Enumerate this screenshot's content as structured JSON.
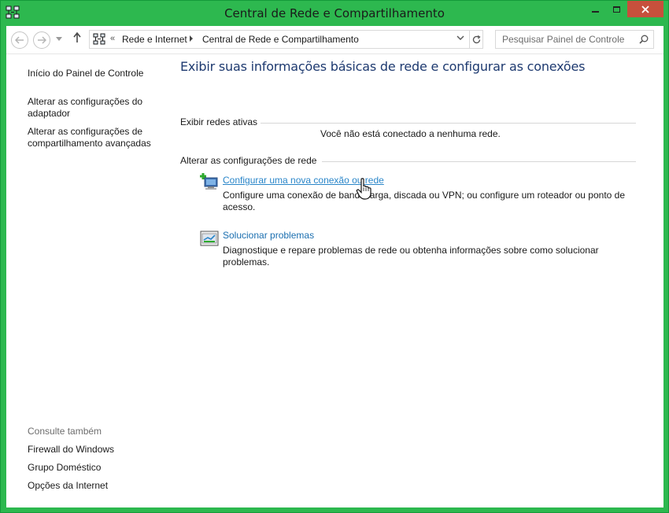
{
  "window": {
    "title": "Central de Rede e Compartilhamento",
    "accent_color": "#2db84f",
    "close_color": "#c7503c",
    "icons": [
      "network-app-icon",
      "minimize-icon",
      "maximize-icon",
      "close-icon"
    ]
  },
  "navigation": {
    "back_icon": "arrow-left-icon",
    "forward_icon": "arrow-right-icon",
    "up_icon": "arrow-up-icon",
    "overflow": "«",
    "breadcrumbs": [
      "Rede e Internet",
      "Central de Rede e Compartilhamento"
    ],
    "search_placeholder": "Pesquisar Painel de Controle"
  },
  "sidebar": {
    "home": "Início do Painel de Controle",
    "links": [
      "Alterar as configurações do adaptador",
      "Alterar as configurações de compartilhamento avançadas"
    ],
    "see_also_title": "Consulte também",
    "see_also": [
      "Firewall do Windows",
      "Grupo Doméstico",
      "Opções da Internet"
    ]
  },
  "main": {
    "title": "Exibir suas informações básicas de rede e configurar as conexões",
    "active_networks_label": "Exibir redes ativas",
    "no_network_text": "Você não está conectado a nenhuma rede.",
    "change_settings_label": "Alterar as configurações de rede",
    "tasks": [
      {
        "icon": "new-connection-icon",
        "link": "Configurar uma nova conexão ou rede",
        "description": "Configure uma conexão de banda larga, discada ou VPN; ou configure um roteador ou ponto de acesso."
      },
      {
        "icon": "troubleshoot-icon",
        "link": "Solucionar problemas",
        "description": "Diagnostique e repare problemas de rede ou obtenha informações sobre como solucionar problemas."
      }
    ],
    "link_color": "#2a86c9",
    "title_color": "#1e3a70"
  }
}
